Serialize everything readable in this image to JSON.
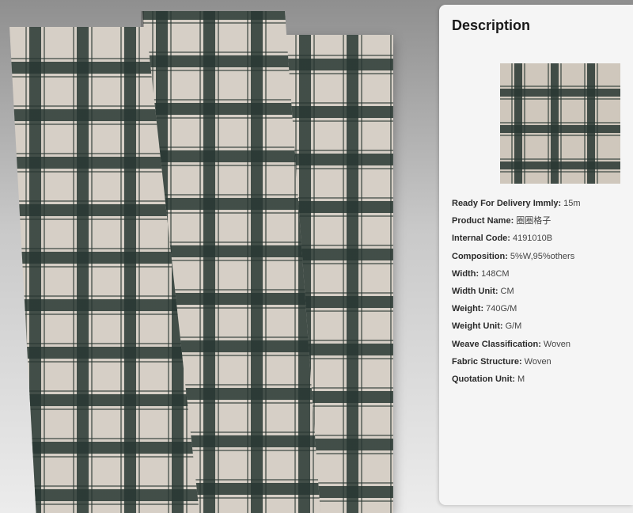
{
  "description": {
    "title": "Description",
    "specs": [
      {
        "label": "Ready For Delivery Immly:",
        "value": "15m"
      },
      {
        "label": "Product Name:",
        "value": "圈圈格子"
      },
      {
        "label": "Internal Code:",
        "value": "4191010B"
      },
      {
        "label": "Composition:",
        "value": "5%W,95%others"
      },
      {
        "label": "Width:",
        "value": "148CM"
      },
      {
        "label": "Width Unit:",
        "value": "CM"
      },
      {
        "label": "Weight:",
        "value": "740G/M"
      },
      {
        "label": "Weight Unit:",
        "value": "G/M"
      },
      {
        "label": "Weave Classification:",
        "value": "Woven"
      },
      {
        "label": "Fabric Structure:",
        "value": "Woven"
      },
      {
        "label": "Quotation Unit:",
        "value": "M"
      }
    ]
  },
  "colors": {
    "fabric_base": "#d6cfc6",
    "fabric_check": "#28372f",
    "panel_bg": "#f5f5f5"
  }
}
